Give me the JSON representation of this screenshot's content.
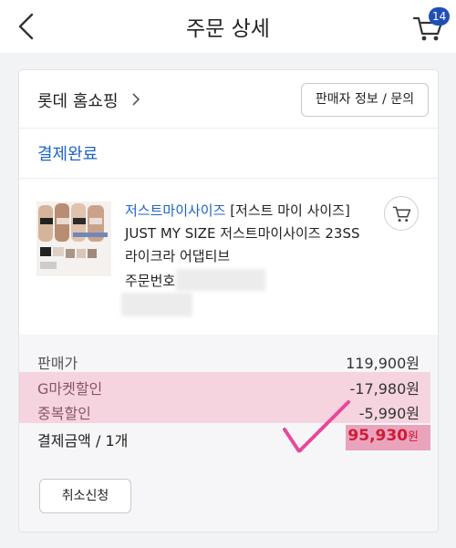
{
  "header": {
    "title": "주문 상세",
    "cart_count": "14"
  },
  "seller": {
    "name": "롯데 홈쇼핑",
    "info_button": "판매자 정보 / 문의"
  },
  "order_status": "결제완료",
  "product": {
    "brand": "저스트마이사이즈",
    "title": "[저스트 마이 사이즈] JUST MY SIZE 저스트마이사이즈 23SS 라이크라 어댑티브",
    "order_number_label": "주문번호"
  },
  "price": {
    "rows": [
      {
        "label": "판매가",
        "value": "119,900원"
      },
      {
        "label": "G마켓할인",
        "value": "-17,980원"
      },
      {
        "label": "중복할인",
        "value": "-5,990원"
      }
    ],
    "total_label": "결제금액 / 1개",
    "total_value": "95,930",
    "total_unit": "원"
  },
  "cancel_button": "취소신청",
  "colors": {
    "accent": "#1e63c6",
    "total": "#d01b35",
    "highlight": "#f5d4df"
  },
  "icons": [
    "back-arrow-icon",
    "cart-icon",
    "chevron-right-icon",
    "add-to-cart-icon",
    "checkmark-icon"
  ]
}
